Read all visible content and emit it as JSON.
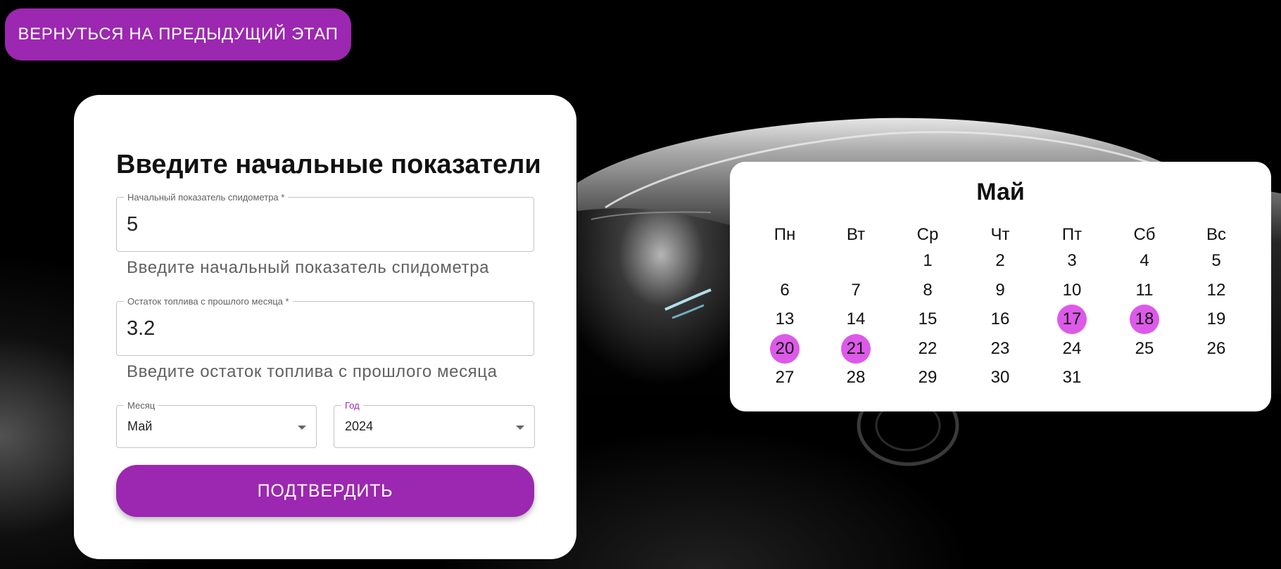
{
  "back_button": {
    "label": "ВЕРНУТЬСЯ НА ПРЕДЫДУЩИЙ ЭТАП"
  },
  "form": {
    "title": "Введите начальные показатели",
    "speedometer": {
      "label": "Начальный показатель спидометра *",
      "value": "5",
      "helper": "Введите начальный показатель спидометра"
    },
    "fuel": {
      "label": "Остаток топлива с прошлого месяца *",
      "value": "3.2",
      "helper": "Введите остаток топлива с прошлого месяца"
    },
    "month": {
      "label": "Месяц",
      "value": "Май"
    },
    "year": {
      "label": "Год",
      "value": "2024"
    },
    "confirm_label": "ПОДТВЕРДИТЬ"
  },
  "calendar": {
    "title": "Май",
    "weekdays": [
      "Пн",
      "Вт",
      "Ср",
      "Чт",
      "Пт",
      "Сб",
      "Вс"
    ],
    "first_weekday_index": 2,
    "days_in_month": 31,
    "highlighted_days": [
      17,
      18,
      20,
      21
    ],
    "highlight_color": "#dc5ae8"
  },
  "colors": {
    "accent": "#9c27b0",
    "background": "#000000",
    "card": "#ffffff"
  }
}
